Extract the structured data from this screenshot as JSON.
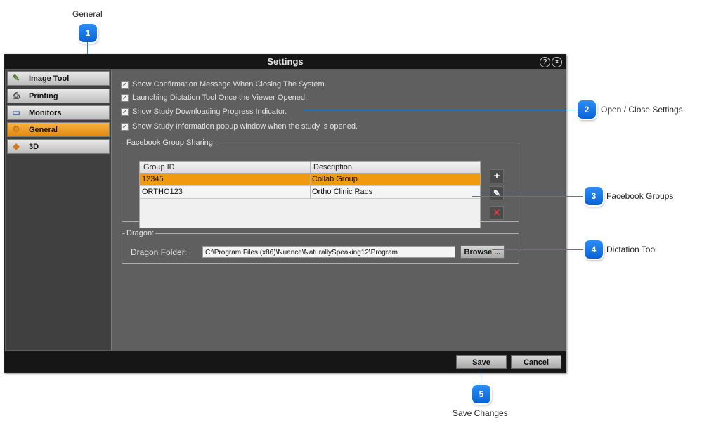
{
  "callouts": [
    {
      "num": "1",
      "label": "General"
    },
    {
      "num": "2",
      "label": "Open / Close Settings"
    },
    {
      "num": "3",
      "label": "Facebook Groups"
    },
    {
      "num": "4",
      "label": "Dictation Tool"
    },
    {
      "num": "5",
      "label": "Save Changes"
    }
  ],
  "window": {
    "title": "Settings",
    "help_icon": "?",
    "close_icon": "×"
  },
  "sidebar": {
    "items": [
      {
        "label": "Image Tool",
        "icon": "image-tool-icon",
        "glyph": "✎"
      },
      {
        "label": "Printing",
        "icon": "printer-icon",
        "glyph": "⎙"
      },
      {
        "label": "Monitors",
        "icon": "monitor-icon",
        "glyph": "▭"
      },
      {
        "label": "General",
        "icon": "gears-icon",
        "glyph": "⚙",
        "active": true
      },
      {
        "label": "3D",
        "icon": "3d-icon",
        "glyph": "◆"
      }
    ]
  },
  "general": {
    "options": [
      {
        "label": "Show Confirmation Message When Closing The System.",
        "checked": true
      },
      {
        "label": "Launching Dictation Tool Once the Viewer Opened.",
        "checked": true
      },
      {
        "label": "Show Study Downloading Progress Indicator.",
        "checked": true
      },
      {
        "label": "Show Study Information popup window when the study is opened.",
        "checked": true
      }
    ],
    "check_glyph": "✓"
  },
  "facebook": {
    "legend": "Facebook Group Sharing",
    "columns": [
      "Group ID",
      "Description"
    ],
    "rows": [
      {
        "id": "12345",
        "description": "Collab Group"
      },
      {
        "id": "ORTHO123",
        "description": "Ortho Clinic Rads"
      }
    ],
    "add_glyph": "+",
    "edit_glyph": "✎",
    "delete_glyph": "✕"
  },
  "dragon": {
    "legend": "Dragon:",
    "folder_label": "Dragon Folder:",
    "folder_value": "C:\\Program Files (x86)\\Nuance\\NaturallySpeaking12\\Program",
    "browse_label": "Browse ..."
  },
  "footer": {
    "save_label": "Save",
    "cancel_label": "Cancel"
  },
  "colors": {
    "accent": "#f09a10",
    "callout": "#0a62d6",
    "titlebar": "#161616"
  }
}
